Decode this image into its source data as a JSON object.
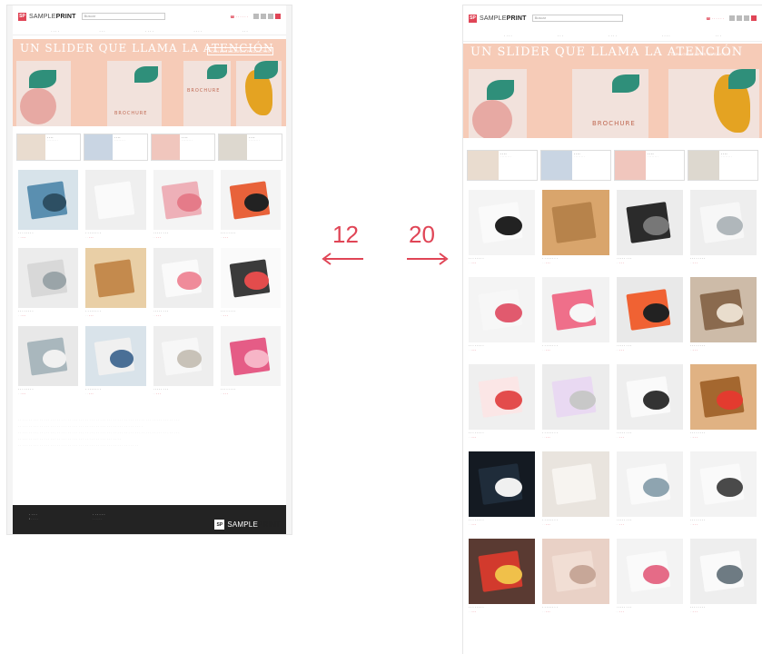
{
  "labels": {
    "left_count": "12",
    "right_count": "20"
  },
  "brand": {
    "mark": "SP",
    "name_light": "SAMPLE",
    "name_bold": "PRINT"
  },
  "left": {
    "search_placeholder": "Buscar",
    "phone": "",
    "nav": [
      "",
      "",
      "",
      "",
      ""
    ],
    "slider_title": "UN SLIDER QUE LLAMA LA ATENCIÓN",
    "slider_sub": "CON LOS MEJORES PRODUCTOS",
    "poster_text": "BROCHURE",
    "categories": [
      {
        "title": "",
        "text": ""
      },
      {
        "title": "",
        "text": ""
      },
      {
        "title": "",
        "text": ""
      },
      {
        "title": "",
        "text": ""
      }
    ],
    "products": [
      {
        "name": "",
        "price": ""
      },
      {
        "name": "",
        "price": ""
      },
      {
        "name": "",
        "price": ""
      },
      {
        "name": "",
        "price": ""
      },
      {
        "name": "",
        "price": ""
      },
      {
        "name": "",
        "price": ""
      },
      {
        "name": "",
        "price": ""
      },
      {
        "name": "",
        "price": ""
      },
      {
        "name": "",
        "price": ""
      },
      {
        "name": "",
        "price": ""
      },
      {
        "name": "",
        "price": ""
      },
      {
        "name": "",
        "price": ""
      }
    ],
    "footer": {
      "col1_title": "",
      "col1_item": "",
      "col2_title": "",
      "col2_item": ""
    }
  },
  "right": {
    "search_placeholder": "Buscar",
    "phone": "",
    "nav": [
      "",
      "",
      "",
      "",
      ""
    ],
    "slider_title": "UN SLIDER QUE LLAMA LA ATENCIÓN",
    "slider_sub": "CON LOS MEJORES PRODUCTOS",
    "poster_text": "BROCHURE",
    "categories": [
      {
        "title": "",
        "text": ""
      },
      {
        "title": "",
        "text": ""
      },
      {
        "title": "",
        "text": ""
      },
      {
        "title": "",
        "text": ""
      }
    ],
    "products": [
      {
        "name": "",
        "price": ""
      },
      {
        "name": "",
        "price": ""
      },
      {
        "name": "",
        "price": ""
      },
      {
        "name": "",
        "price": ""
      },
      {
        "name": "",
        "price": ""
      },
      {
        "name": "",
        "price": ""
      },
      {
        "name": "",
        "price": ""
      },
      {
        "name": "",
        "price": ""
      },
      {
        "name": "",
        "price": ""
      },
      {
        "name": "",
        "price": ""
      },
      {
        "name": "",
        "price": ""
      },
      {
        "name": "",
        "price": ""
      },
      {
        "name": "",
        "price": ""
      },
      {
        "name": "",
        "price": ""
      },
      {
        "name": "",
        "price": ""
      },
      {
        "name": "",
        "price": ""
      },
      {
        "name": "",
        "price": ""
      },
      {
        "name": "",
        "price": ""
      },
      {
        "name": "",
        "price": ""
      },
      {
        "name": "",
        "price": ""
      }
    ]
  },
  "colors": {
    "accent": "#e04556",
    "slider_bg": "#f6cbb7",
    "footer_bg": "#232323"
  }
}
